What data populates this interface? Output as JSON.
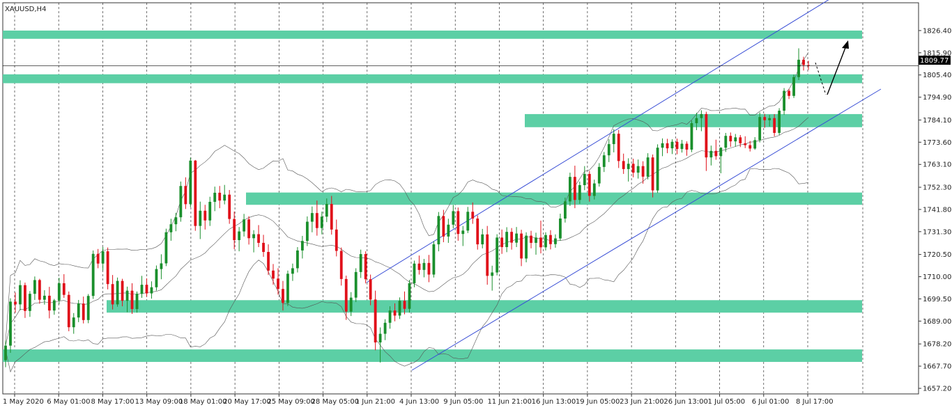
{
  "symbol": "XAUUSD,H4",
  "current_price": "1809.77",
  "colors": {
    "bull": "#1a8f2c",
    "bear": "#e0101a",
    "zone": "#5ccfa5",
    "channel": "#3a4fd6",
    "bands": "#555555",
    "grid": "#333333",
    "arrow": "#000000"
  },
  "chart_data": {
    "type": "candlestick",
    "title": "XAUUSD,H4",
    "ylim": [
      1657.2,
      1836.9
    ],
    "y_ticks": [
      "1826.40",
      "1815.90",
      "1805.40",
      "1794.90",
      "1784.10",
      "1773.60",
      "1763.10",
      "1752.30",
      "1741.80",
      "1731.30",
      "1720.50",
      "1710.00",
      "1699.50",
      "1689.00",
      "1678.20",
      "1667.70",
      "1657.20"
    ],
    "x_ticks": [
      "1 May 2020",
      "6 May 01:00",
      "8 May 17:00",
      "13 May 09:00",
      "18 May 01:00",
      "20 May 17:00",
      "25 May 09:00",
      "28 May 05:00",
      "1 Jun 21:00",
      "4 Jun 13:00",
      "9 Jun 05:00",
      "11 Jun 21:00",
      "16 Jun 13:00",
      "19 Jun 05:00",
      "23 Jun 21:00",
      "26 Jun 13:00",
      "1 Jul 05:00",
      "6 Jul 01:00",
      "8 Jul 17:00"
    ],
    "grid": "vertical dashed",
    "support_resistance_zones": [
      {
        "from": 1822.5,
        "to": 1826.4
      },
      {
        "from": 1801.5,
        "to": 1805.7
      },
      {
        "from": 1780.7,
        "to": 1786.9
      },
      {
        "from": 1744.0,
        "to": 1749.8
      },
      {
        "from": 1693.0,
        "to": 1698.9
      },
      {
        "from": 1669.7,
        "to": 1675.6
      }
    ],
    "channel_lines": [
      {
        "x_from": "1 Jun 21:00",
        "y_from": 1712.0,
        "x_to": "8 Jul 17:00",
        "y_to": 1838.0
      },
      {
        "x_from": "4 Jun 13:00",
        "y_from": 1666.0,
        "x_to": "8 Jul 17:00",
        "y_to": 1796.0
      }
    ],
    "candles": [
      {
        "o": 1670.5,
        "h": 1679.8,
        "l": 1667.2,
        "c": 1677.4
      },
      {
        "o": 1677.4,
        "h": 1699.8,
        "l": 1674.0,
        "c": 1698.2
      },
      {
        "o": 1698.2,
        "h": 1702.5,
        "l": 1693.0,
        "c": 1696.9
      },
      {
        "o": 1696.9,
        "h": 1708.3,
        "l": 1694.1,
        "c": 1706.0
      },
      {
        "o": 1706.0,
        "h": 1707.2,
        "l": 1690.5,
        "c": 1693.8
      },
      {
        "o": 1693.8,
        "h": 1703.2,
        "l": 1691.0,
        "c": 1701.9
      },
      {
        "o": 1701.9,
        "h": 1710.1,
        "l": 1699.0,
        "c": 1708.4
      },
      {
        "o": 1708.4,
        "h": 1709.0,
        "l": 1697.2,
        "c": 1699.1
      },
      {
        "o": 1699.1,
        "h": 1703.6,
        "l": 1696.8,
        "c": 1701.0
      },
      {
        "o": 1701.0,
        "h": 1705.2,
        "l": 1690.3,
        "c": 1694.0
      },
      {
        "o": 1694.0,
        "h": 1699.5,
        "l": 1692.0,
        "c": 1698.8
      },
      {
        "o": 1698.8,
        "h": 1709.5,
        "l": 1697.0,
        "c": 1706.9
      },
      {
        "o": 1706.9,
        "h": 1711.2,
        "l": 1700.0,
        "c": 1701.4
      },
      {
        "o": 1701.4,
        "h": 1703.0,
        "l": 1684.2,
        "c": 1686.1
      },
      {
        "o": 1686.1,
        "h": 1692.8,
        "l": 1683.0,
        "c": 1690.7
      },
      {
        "o": 1690.7,
        "h": 1699.0,
        "l": 1688.5,
        "c": 1697.3
      },
      {
        "o": 1697.3,
        "h": 1700.6,
        "l": 1687.9,
        "c": 1689.5
      },
      {
        "o": 1689.5,
        "h": 1701.8,
        "l": 1688.0,
        "c": 1700.9
      },
      {
        "o": 1700.9,
        "h": 1722.4,
        "l": 1699.5,
        "c": 1720.8
      },
      {
        "o": 1720.8,
        "h": 1723.1,
        "l": 1714.0,
        "c": 1716.2
      },
      {
        "o": 1716.2,
        "h": 1724.0,
        "l": 1713.0,
        "c": 1722.0
      },
      {
        "o": 1722.0,
        "h": 1723.8,
        "l": 1704.0,
        "c": 1706.5
      },
      {
        "o": 1706.5,
        "h": 1710.8,
        "l": 1694.5,
        "c": 1696.9
      },
      {
        "o": 1696.9,
        "h": 1709.6,
        "l": 1695.8,
        "c": 1708.0
      },
      {
        "o": 1708.0,
        "h": 1709.0,
        "l": 1696.0,
        "c": 1698.6
      },
      {
        "o": 1698.6,
        "h": 1705.3,
        "l": 1693.2,
        "c": 1703.4
      },
      {
        "o": 1703.4,
        "h": 1706.9,
        "l": 1692.4,
        "c": 1694.7
      },
      {
        "o": 1694.7,
        "h": 1703.0,
        "l": 1693.0,
        "c": 1701.9
      },
      {
        "o": 1701.9,
        "h": 1710.4,
        "l": 1700.0,
        "c": 1706.2
      },
      {
        "o": 1706.2,
        "h": 1709.2,
        "l": 1700.6,
        "c": 1702.1
      },
      {
        "o": 1702.1,
        "h": 1707.8,
        "l": 1699.6,
        "c": 1705.0
      },
      {
        "o": 1705.0,
        "h": 1715.3,
        "l": 1703.4,
        "c": 1713.6
      },
      {
        "o": 1713.6,
        "h": 1720.6,
        "l": 1708.8,
        "c": 1716.3
      },
      {
        "o": 1716.3,
        "h": 1732.7,
        "l": 1715.0,
        "c": 1731.0
      },
      {
        "o": 1731.0,
        "h": 1737.4,
        "l": 1727.0,
        "c": 1734.8
      },
      {
        "o": 1734.8,
        "h": 1740.2,
        "l": 1731.5,
        "c": 1738.1
      },
      {
        "o": 1738.1,
        "h": 1755.0,
        "l": 1736.0,
        "c": 1752.9
      },
      {
        "o": 1752.9,
        "h": 1757.0,
        "l": 1742.0,
        "c": 1744.3
      },
      {
        "o": 1744.3,
        "h": 1766.3,
        "l": 1742.8,
        "c": 1764.9
      },
      {
        "o": 1764.9,
        "h": 1765.2,
        "l": 1731.7,
        "c": 1734.0
      },
      {
        "o": 1734.0,
        "h": 1745.5,
        "l": 1727.8,
        "c": 1741.2
      },
      {
        "o": 1741.2,
        "h": 1744.0,
        "l": 1732.3,
        "c": 1736.6
      },
      {
        "o": 1736.6,
        "h": 1747.8,
        "l": 1734.0,
        "c": 1745.4
      },
      {
        "o": 1745.4,
        "h": 1752.6,
        "l": 1741.0,
        "c": 1749.7
      },
      {
        "o": 1749.7,
        "h": 1752.9,
        "l": 1742.4,
        "c": 1746.0
      },
      {
        "o": 1746.0,
        "h": 1753.4,
        "l": 1744.2,
        "c": 1748.8
      },
      {
        "o": 1748.8,
        "h": 1751.0,
        "l": 1735.0,
        "c": 1737.3
      },
      {
        "o": 1737.3,
        "h": 1740.8,
        "l": 1723.0,
        "c": 1727.3
      },
      {
        "o": 1727.3,
        "h": 1733.5,
        "l": 1722.0,
        "c": 1731.4
      },
      {
        "o": 1731.4,
        "h": 1739.7,
        "l": 1729.0,
        "c": 1737.1
      },
      {
        "o": 1737.1,
        "h": 1738.6,
        "l": 1725.2,
        "c": 1728.2
      },
      {
        "o": 1728.2,
        "h": 1732.0,
        "l": 1721.5,
        "c": 1730.1
      },
      {
        "o": 1730.1,
        "h": 1734.4,
        "l": 1724.0,
        "c": 1726.0
      },
      {
        "o": 1726.0,
        "h": 1729.8,
        "l": 1719.4,
        "c": 1721.7
      },
      {
        "o": 1721.7,
        "h": 1725.3,
        "l": 1710.8,
        "c": 1712.9
      },
      {
        "o": 1712.9,
        "h": 1716.0,
        "l": 1706.2,
        "c": 1709.1
      },
      {
        "o": 1709.1,
        "h": 1714.0,
        "l": 1701.5,
        "c": 1704.2
      },
      {
        "o": 1704.2,
        "h": 1708.0,
        "l": 1694.0,
        "c": 1697.6
      },
      {
        "o": 1697.6,
        "h": 1712.9,
        "l": 1696.1,
        "c": 1711.4
      },
      {
        "o": 1711.4,
        "h": 1716.2,
        "l": 1708.0,
        "c": 1714.0
      },
      {
        "o": 1714.0,
        "h": 1724.0,
        "l": 1712.0,
        "c": 1722.4
      },
      {
        "o": 1722.4,
        "h": 1729.3,
        "l": 1718.6,
        "c": 1726.9
      },
      {
        "o": 1726.9,
        "h": 1738.5,
        "l": 1724.5,
        "c": 1736.0
      },
      {
        "o": 1736.0,
        "h": 1743.2,
        "l": 1731.0,
        "c": 1740.1
      },
      {
        "o": 1740.1,
        "h": 1746.0,
        "l": 1729.4,
        "c": 1733.0
      },
      {
        "o": 1733.0,
        "h": 1740.8,
        "l": 1730.0,
        "c": 1738.4
      },
      {
        "o": 1738.4,
        "h": 1747.0,
        "l": 1735.8,
        "c": 1744.4
      },
      {
        "o": 1744.4,
        "h": 1748.2,
        "l": 1729.9,
        "c": 1732.3
      },
      {
        "o": 1732.3,
        "h": 1737.0,
        "l": 1719.6,
        "c": 1722.2
      },
      {
        "o": 1722.2,
        "h": 1723.8,
        "l": 1705.8,
        "c": 1708.9
      },
      {
        "o": 1708.9,
        "h": 1710.5,
        "l": 1689.6,
        "c": 1693.5
      },
      {
        "o": 1693.5,
        "h": 1702.7,
        "l": 1691.4,
        "c": 1700.1
      },
      {
        "o": 1700.1,
        "h": 1714.0,
        "l": 1698.0,
        "c": 1712.2
      },
      {
        "o": 1712.2,
        "h": 1722.8,
        "l": 1709.4,
        "c": 1720.7
      },
      {
        "o": 1720.7,
        "h": 1722.0,
        "l": 1706.8,
        "c": 1708.8
      },
      {
        "o": 1708.8,
        "h": 1711.0,
        "l": 1696.5,
        "c": 1699.2
      },
      {
        "o": 1699.2,
        "h": 1703.4,
        "l": 1675.2,
        "c": 1678.9
      },
      {
        "o": 1678.9,
        "h": 1686.0,
        "l": 1669.4,
        "c": 1683.0
      },
      {
        "o": 1683.0,
        "h": 1689.9,
        "l": 1680.0,
        "c": 1688.2
      },
      {
        "o": 1688.2,
        "h": 1696.0,
        "l": 1685.4,
        "c": 1694.0
      },
      {
        "o": 1694.0,
        "h": 1697.4,
        "l": 1688.9,
        "c": 1691.6
      },
      {
        "o": 1691.6,
        "h": 1700.2,
        "l": 1690.0,
        "c": 1698.6
      },
      {
        "o": 1698.6,
        "h": 1703.0,
        "l": 1692.2,
        "c": 1694.8
      },
      {
        "o": 1694.8,
        "h": 1708.5,
        "l": 1693.0,
        "c": 1706.9
      },
      {
        "o": 1706.9,
        "h": 1717.6,
        "l": 1705.0,
        "c": 1716.2
      },
      {
        "o": 1716.2,
        "h": 1720.0,
        "l": 1711.0,
        "c": 1713.2
      },
      {
        "o": 1713.2,
        "h": 1718.4,
        "l": 1709.7,
        "c": 1716.5
      },
      {
        "o": 1716.5,
        "h": 1720.3,
        "l": 1707.4,
        "c": 1711.0
      },
      {
        "o": 1711.0,
        "h": 1726.8,
        "l": 1709.6,
        "c": 1725.3
      },
      {
        "o": 1725.3,
        "h": 1740.6,
        "l": 1722.0,
        "c": 1738.7
      },
      {
        "o": 1738.7,
        "h": 1741.6,
        "l": 1726.3,
        "c": 1729.0
      },
      {
        "o": 1729.0,
        "h": 1737.4,
        "l": 1726.0,
        "c": 1734.6
      },
      {
        "o": 1734.6,
        "h": 1743.9,
        "l": 1732.8,
        "c": 1741.0
      },
      {
        "o": 1741.0,
        "h": 1742.7,
        "l": 1727.0,
        "c": 1730.2
      },
      {
        "o": 1730.2,
        "h": 1734.0,
        "l": 1724.5,
        "c": 1731.8
      },
      {
        "o": 1731.8,
        "h": 1743.0,
        "l": 1730.6,
        "c": 1740.7
      },
      {
        "o": 1740.7,
        "h": 1745.1,
        "l": 1735.0,
        "c": 1737.5
      },
      {
        "o": 1737.5,
        "h": 1739.0,
        "l": 1722.8,
        "c": 1725.3
      },
      {
        "o": 1725.3,
        "h": 1732.6,
        "l": 1723.4,
        "c": 1730.0
      },
      {
        "o": 1730.0,
        "h": 1734.0,
        "l": 1706.2,
        "c": 1710.4
      },
      {
        "o": 1710.4,
        "h": 1715.2,
        "l": 1703.4,
        "c": 1712.0
      },
      {
        "o": 1712.0,
        "h": 1730.1,
        "l": 1710.6,
        "c": 1728.5
      },
      {
        "o": 1728.5,
        "h": 1732.3,
        "l": 1720.8,
        "c": 1724.0
      },
      {
        "o": 1724.0,
        "h": 1733.4,
        "l": 1721.6,
        "c": 1731.2
      },
      {
        "o": 1731.2,
        "h": 1733.0,
        "l": 1722.8,
        "c": 1726.1
      },
      {
        "o": 1726.1,
        "h": 1733.5,
        "l": 1724.0,
        "c": 1730.4
      },
      {
        "o": 1730.4,
        "h": 1732.2,
        "l": 1715.0,
        "c": 1718.6
      },
      {
        "o": 1718.6,
        "h": 1731.0,
        "l": 1716.8,
        "c": 1729.4
      },
      {
        "o": 1729.4,
        "h": 1731.7,
        "l": 1723.4,
        "c": 1726.0
      },
      {
        "o": 1726.0,
        "h": 1730.8,
        "l": 1720.4,
        "c": 1728.5
      },
      {
        "o": 1728.5,
        "h": 1736.5,
        "l": 1721.0,
        "c": 1723.9
      },
      {
        "o": 1723.9,
        "h": 1731.0,
        "l": 1722.4,
        "c": 1729.7
      },
      {
        "o": 1729.7,
        "h": 1732.0,
        "l": 1722.9,
        "c": 1725.4
      },
      {
        "o": 1725.4,
        "h": 1730.0,
        "l": 1723.7,
        "c": 1728.1
      },
      {
        "o": 1728.1,
        "h": 1739.8,
        "l": 1727.0,
        "c": 1737.5
      },
      {
        "o": 1737.5,
        "h": 1747.4,
        "l": 1735.6,
        "c": 1745.6
      },
      {
        "o": 1745.6,
        "h": 1759.2,
        "l": 1743.5,
        "c": 1757.2
      },
      {
        "o": 1757.2,
        "h": 1762.5,
        "l": 1742.4,
        "c": 1746.3
      },
      {
        "o": 1746.3,
        "h": 1755.0,
        "l": 1744.5,
        "c": 1753.3
      },
      {
        "o": 1753.3,
        "h": 1762.3,
        "l": 1750.9,
        "c": 1758.6
      },
      {
        "o": 1758.6,
        "h": 1760.0,
        "l": 1745.5,
        "c": 1748.2
      },
      {
        "o": 1748.2,
        "h": 1755.9,
        "l": 1746.5,
        "c": 1754.1
      },
      {
        "o": 1754.1,
        "h": 1763.7,
        "l": 1752.6,
        "c": 1761.9
      },
      {
        "o": 1761.9,
        "h": 1769.0,
        "l": 1759.5,
        "c": 1767.4
      },
      {
        "o": 1767.4,
        "h": 1775.0,
        "l": 1764.2,
        "c": 1772.7
      },
      {
        "o": 1772.7,
        "h": 1779.8,
        "l": 1768.8,
        "c": 1777.6
      },
      {
        "o": 1777.6,
        "h": 1779.4,
        "l": 1761.4,
        "c": 1764.7
      },
      {
        "o": 1764.7,
        "h": 1768.2,
        "l": 1758.6,
        "c": 1760.9
      },
      {
        "o": 1760.9,
        "h": 1766.0,
        "l": 1755.0,
        "c": 1763.4
      },
      {
        "o": 1763.4,
        "h": 1765.8,
        "l": 1757.0,
        "c": 1759.2
      },
      {
        "o": 1759.2,
        "h": 1765.4,
        "l": 1756.4,
        "c": 1762.3
      },
      {
        "o": 1762.3,
        "h": 1764.6,
        "l": 1754.0,
        "c": 1757.3
      },
      {
        "o": 1757.3,
        "h": 1768.4,
        "l": 1756.0,
        "c": 1766.4
      },
      {
        "o": 1766.4,
        "h": 1767.8,
        "l": 1747.5,
        "c": 1750.8
      },
      {
        "o": 1750.8,
        "h": 1772.6,
        "l": 1749.6,
        "c": 1771.0
      },
      {
        "o": 1771.0,
        "h": 1775.4,
        "l": 1767.0,
        "c": 1773.1
      },
      {
        "o": 1773.1,
        "h": 1775.2,
        "l": 1768.4,
        "c": 1770.7
      },
      {
        "o": 1770.7,
        "h": 1775.0,
        "l": 1768.0,
        "c": 1773.8
      },
      {
        "o": 1773.8,
        "h": 1775.3,
        "l": 1767.9,
        "c": 1770.4
      },
      {
        "o": 1770.4,
        "h": 1774.7,
        "l": 1768.7,
        "c": 1772.9
      },
      {
        "o": 1772.9,
        "h": 1774.0,
        "l": 1767.2,
        "c": 1770.1
      },
      {
        "o": 1770.1,
        "h": 1783.8,
        "l": 1768.9,
        "c": 1782.6
      },
      {
        "o": 1782.6,
        "h": 1787.5,
        "l": 1779.3,
        "c": 1785.0
      },
      {
        "o": 1785.0,
        "h": 1788.7,
        "l": 1778.8,
        "c": 1786.9
      },
      {
        "o": 1786.9,
        "h": 1788.0,
        "l": 1760.0,
        "c": 1766.4
      },
      {
        "o": 1766.4,
        "h": 1772.0,
        "l": 1762.6,
        "c": 1769.5
      },
      {
        "o": 1769.5,
        "h": 1774.8,
        "l": 1765.3,
        "c": 1767.0
      },
      {
        "o": 1767.0,
        "h": 1771.2,
        "l": 1758.9,
        "c": 1771.0
      },
      {
        "o": 1771.0,
        "h": 1778.0,
        "l": 1769.0,
        "c": 1776.6
      },
      {
        "o": 1776.6,
        "h": 1778.2,
        "l": 1771.4,
        "c": 1774.0
      },
      {
        "o": 1774.0,
        "h": 1777.5,
        "l": 1771.5,
        "c": 1775.9
      },
      {
        "o": 1775.9,
        "h": 1777.0,
        "l": 1771.3,
        "c": 1773.1
      },
      {
        "o": 1773.1,
        "h": 1776.4,
        "l": 1770.8,
        "c": 1772.2
      },
      {
        "o": 1772.2,
        "h": 1774.2,
        "l": 1769.2,
        "c": 1770.6
      },
      {
        "o": 1770.6,
        "h": 1776.0,
        "l": 1770.0,
        "c": 1774.6
      },
      {
        "o": 1774.6,
        "h": 1787.7,
        "l": 1773.5,
        "c": 1785.5
      },
      {
        "o": 1785.5,
        "h": 1787.0,
        "l": 1780.4,
        "c": 1784.0
      },
      {
        "o": 1784.0,
        "h": 1786.5,
        "l": 1781.0,
        "c": 1785.0
      },
      {
        "o": 1785.0,
        "h": 1786.9,
        "l": 1776.4,
        "c": 1778.0
      },
      {
        "o": 1778.0,
        "h": 1789.7,
        "l": 1777.0,
        "c": 1788.5
      },
      {
        "o": 1788.5,
        "h": 1799.2,
        "l": 1786.5,
        "c": 1797.9
      },
      {
        "o": 1797.9,
        "h": 1798.8,
        "l": 1794.0,
        "c": 1795.5
      },
      {
        "o": 1795.5,
        "h": 1805.6,
        "l": 1794.5,
        "c": 1804.4
      },
      {
        "o": 1804.4,
        "h": 1818.0,
        "l": 1803.0,
        "c": 1812.6
      },
      {
        "o": 1812.6,
        "h": 1814.0,
        "l": 1807.5,
        "c": 1810.1
      },
      {
        "o": 1810.1,
        "h": 1812.1,
        "l": 1807.8,
        "c": 1809.8
      }
    ]
  }
}
